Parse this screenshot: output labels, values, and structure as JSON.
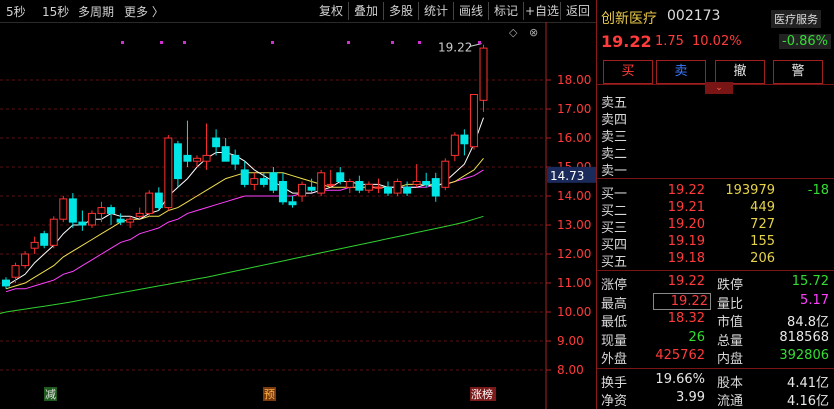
{
  "toolbar": {
    "periods": [
      "5秒",
      "15秒",
      "多周期",
      "更多 〉"
    ],
    "buttons": [
      "复权",
      "叠加",
      "多股",
      "统计",
      "画线",
      "标记",
      "+自选",
      "返回"
    ]
  },
  "chart": {
    "y_ticks": [
      "18.00",
      "17.00",
      "16.00",
      "15.00",
      "14.00",
      "13.00",
      "12.00",
      "11.00",
      "10.00",
      "9.00",
      "8.00"
    ],
    "current_price_tag": "14.73",
    "high_callout": "19.22",
    "markers": [
      "减",
      "预",
      "涨榜"
    ],
    "colors": {
      "up": "#ff3030",
      "down": "#00e5e5",
      "ma5": "#ffffff",
      "ma10": "#f0e050",
      "ma20": "#ff40ff",
      "ma60": "#30d030"
    }
  },
  "chart_data": {
    "type": "candlestick",
    "ylim": [
      8.0,
      18.8
    ],
    "y_ticks": [
      8,
      9,
      10,
      11,
      12,
      13,
      14,
      15,
      16,
      17,
      18
    ],
    "candles": [
      [
        11.1,
        11.2,
        10.8,
        10.9
      ],
      [
        11.2,
        11.7,
        11.0,
        11.6
      ],
      [
        11.6,
        12.1,
        11.5,
        12.0
      ],
      [
        12.2,
        12.6,
        12.0,
        12.4
      ],
      [
        12.7,
        12.8,
        12.2,
        12.3
      ],
      [
        12.3,
        13.3,
        12.2,
        13.2
      ],
      [
        13.2,
        14.0,
        13.1,
        13.9
      ],
      [
        13.9,
        14.1,
        12.9,
        13.1
      ],
      [
        13.1,
        13.5,
        12.8,
        13.0
      ],
      [
        13.0,
        13.5,
        12.9,
        13.4
      ],
      [
        13.4,
        13.8,
        13.1,
        13.6
      ],
      [
        13.6,
        13.7,
        13.0,
        13.4
      ],
      [
        13.2,
        13.4,
        13.0,
        13.1
      ],
      [
        13.1,
        13.3,
        12.9,
        13.2
      ],
      [
        13.3,
        13.6,
        13.2,
        13.4
      ],
      [
        13.4,
        14.2,
        13.3,
        14.1
      ],
      [
        14.1,
        14.3,
        13.5,
        13.6
      ],
      [
        13.6,
        16.1,
        13.5,
        16.0
      ],
      [
        15.8,
        15.9,
        14.3,
        14.6
      ],
      [
        15.4,
        16.6,
        15.0,
        15.2
      ],
      [
        15.2,
        15.4,
        15.0,
        15.3
      ],
      [
        15.2,
        16.5,
        14.9,
        15.4
      ],
      [
        16.0,
        16.3,
        15.4,
        15.7
      ],
      [
        15.7,
        16.0,
        15.2,
        15.2
      ],
      [
        15.4,
        15.6,
        14.9,
        15.1
      ],
      [
        14.9,
        15.2,
        14.3,
        14.4
      ],
      [
        14.4,
        14.8,
        14.2,
        14.6
      ],
      [
        14.6,
        14.8,
        14.3,
        14.4
      ],
      [
        14.8,
        15.0,
        14.1,
        14.2
      ],
      [
        14.5,
        14.8,
        13.7,
        13.8
      ],
      [
        13.8,
        14.0,
        13.6,
        13.7
      ],
      [
        14.0,
        14.5,
        13.8,
        14.4
      ],
      [
        14.3,
        14.6,
        14.1,
        14.2
      ],
      [
        14.1,
        14.9,
        14.0,
        14.8
      ],
      [
        14.4,
        14.9,
        14.3,
        14.4
      ],
      [
        14.8,
        15.0,
        14.4,
        14.5
      ],
      [
        14.3,
        14.6,
        14.1,
        14.5
      ],
      [
        14.5,
        14.7,
        14.1,
        14.2
      ],
      [
        14.2,
        14.5,
        14.1,
        14.4
      ],
      [
        14.3,
        14.6,
        14.1,
        14.3
      ],
      [
        14.3,
        14.5,
        14.0,
        14.1
      ],
      [
        14.1,
        14.6,
        14.0,
        14.5
      ],
      [
        14.3,
        14.5,
        14.0,
        14.1
      ],
      [
        14.4,
        15.1,
        14.3,
        14.5
      ],
      [
        14.5,
        14.8,
        14.3,
        14.4
      ],
      [
        14.6,
        14.8,
        13.8,
        14.0
      ],
      [
        14.3,
        15.3,
        14.2,
        15.2
      ],
      [
        15.4,
        16.2,
        15.2,
        16.1
      ],
      [
        16.1,
        16.3,
        15.4,
        15.8
      ],
      [
        15.7,
        17.5,
        15.6,
        17.5
      ],
      [
        17.3,
        19.22,
        16.9,
        19.1
      ]
    ],
    "ma5": [
      10.9,
      11.1,
      11.3,
      11.7,
      12.0,
      12.3,
      12.7,
      13.0,
      13.0,
      13.2,
      13.2,
      13.4,
      13.3,
      13.3,
      13.2,
      13.4,
      13.5,
      14.0,
      14.3,
      14.6,
      15.0,
      15.3,
      15.5,
      15.5,
      15.4,
      15.2,
      14.9,
      14.7,
      14.5,
      14.3,
      14.1,
      14.1,
      14.1,
      14.2,
      14.3,
      14.5,
      14.5,
      14.4,
      14.4,
      14.4,
      14.3,
      14.3,
      14.3,
      14.3,
      14.4,
      14.3,
      14.5,
      14.8,
      15.1,
      15.8,
      16.7
    ],
    "ma10": [
      10.8,
      10.9,
      11.0,
      11.2,
      11.4,
      11.6,
      11.9,
      12.1,
      12.3,
      12.5,
      12.7,
      12.9,
      13.1,
      13.2,
      13.2,
      13.3,
      13.3,
      13.5,
      13.6,
      13.8,
      14.0,
      14.2,
      14.4,
      14.6,
      14.7,
      14.8,
      14.8,
      14.8,
      14.8,
      14.8,
      14.7,
      14.6,
      14.5,
      14.4,
      14.3,
      14.3,
      14.3,
      14.3,
      14.3,
      14.3,
      14.3,
      14.3,
      14.4,
      14.4,
      14.4,
      14.4,
      14.4,
      14.5,
      14.7,
      14.9,
      15.3
    ],
    "ma20": [
      10.7,
      10.8,
      10.8,
      10.9,
      11.0,
      11.1,
      11.3,
      11.4,
      11.6,
      11.8,
      12.0,
      12.2,
      12.4,
      12.5,
      12.7,
      12.8,
      12.9,
      13.1,
      13.2,
      13.4,
      13.5,
      13.6,
      13.7,
      13.8,
      13.9,
      14.0,
      14.0,
      14.0,
      14.0,
      14.0,
      14.0,
      14.1,
      14.1,
      14.2,
      14.2,
      14.2,
      14.3,
      14.3,
      14.3,
      14.3,
      14.3,
      14.3,
      14.3,
      14.3,
      14.3,
      14.4,
      14.4,
      14.5,
      14.6,
      14.7,
      14.9
    ],
    "ma60": [
      10.0,
      10.05,
      10.1,
      10.15,
      10.2,
      10.25,
      10.3,
      10.36,
      10.42,
      10.48,
      10.54,
      10.6,
      10.66,
      10.72,
      10.78,
      10.84,
      10.9,
      10.96,
      11.02,
      11.08,
      11.14,
      11.2,
      11.27,
      11.34,
      11.41,
      11.48,
      11.55,
      11.62,
      11.69,
      11.76,
      11.83,
      11.9,
      11.97,
      12.04,
      12.11,
      12.18,
      12.25,
      12.32,
      12.39,
      12.46,
      12.53,
      12.6,
      12.67,
      12.74,
      12.81,
      12.88,
      12.95,
      13.02,
      13.1,
      13.2,
      13.3
    ]
  },
  "quote": {
    "name": "创新医疗",
    "code": "002173",
    "sector": "医疗服务",
    "price": "19.22",
    "change": "1.75",
    "change_pct": "10.02%",
    "sector_change": "-0.86%",
    "trade_buttons": [
      "买",
      "卖",
      "撤",
      "警"
    ],
    "sell_labels": [
      "卖五",
      "卖四",
      "卖三",
      "卖二",
      "卖一"
    ],
    "buy_rows": [
      {
        "label": "买一",
        "price": "19.22",
        "vol": "193979",
        "delta": "-18"
      },
      {
        "label": "买二",
        "price": "19.21",
        "vol": "449",
        "delta": ""
      },
      {
        "label": "买三",
        "price": "19.20",
        "vol": "727",
        "delta": ""
      },
      {
        "label": "买四",
        "price": "19.19",
        "vol": "155",
        "delta": ""
      },
      {
        "label": "买五",
        "price": "19.18",
        "vol": "206",
        "delta": ""
      }
    ],
    "stats": [
      {
        "l1": "涨停",
        "v1": "19.22",
        "c1": "red",
        "l2": "跌停",
        "v2": "15.72",
        "c2": "green"
      },
      {
        "l1": "最高",
        "v1": "19.22",
        "c1": "red",
        "l2": "量比",
        "v2": "5.17",
        "c2": "mag"
      },
      {
        "l1": "最低",
        "v1": "18.32",
        "c1": "red",
        "l2": "市值",
        "v2": "84.8亿",
        "c2": "white"
      },
      {
        "l1": "现量",
        "v1": "26",
        "c1": "green",
        "l2": "总量",
        "v2": "818568",
        "c2": "white"
      },
      {
        "l1": "外盘",
        "v1": "425762",
        "c1": "red",
        "l2": "内盘",
        "v2": "392806",
        "c2": "green"
      }
    ],
    "stats2": [
      {
        "l1": "换手",
        "v1": "19.66%",
        "l2": "股本",
        "v2": "4.41亿"
      },
      {
        "l1": "净资",
        "v1": "3.99",
        "l2": "流通",
        "v2": "4.16亿"
      }
    ]
  }
}
